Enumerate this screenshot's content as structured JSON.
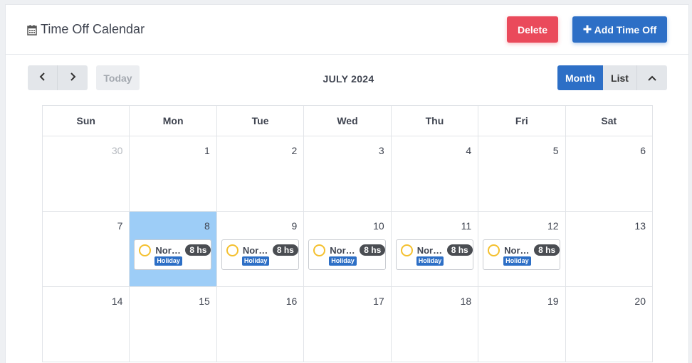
{
  "header": {
    "title": "Time Off Calendar",
    "delete_label": "Delete",
    "add_label": "Add Time Off"
  },
  "toolbar": {
    "today_label": "Today",
    "month_label": "JULY 2024",
    "view_month": "Month",
    "view_list": "List"
  },
  "calendar": {
    "weekdays": [
      "Sun",
      "Mon",
      "Tue",
      "Wed",
      "Thu",
      "Fri",
      "Sat"
    ],
    "weeks": [
      [
        {
          "day": "30",
          "other_month": true
        },
        {
          "day": "1"
        },
        {
          "day": "2"
        },
        {
          "day": "3"
        },
        {
          "day": "4"
        },
        {
          "day": "5"
        },
        {
          "day": "6"
        }
      ],
      [
        {
          "day": "7"
        },
        {
          "day": "8",
          "today": true,
          "event": {
            "name": "Nora...",
            "hours": "8 hs",
            "tag": "Holiday"
          }
        },
        {
          "day": "9",
          "event": {
            "name": "Nora...",
            "hours": "8 hs",
            "tag": "Holiday"
          }
        },
        {
          "day": "10",
          "event": {
            "name": "Nora...",
            "hours": "8 hs",
            "tag": "Holiday"
          }
        },
        {
          "day": "11",
          "event": {
            "name": "Nora...",
            "hours": "8 hs",
            "tag": "Holiday"
          }
        },
        {
          "day": "12",
          "event": {
            "name": "Nora...",
            "hours": "8 hs",
            "tag": "Holiday"
          }
        },
        {
          "day": "13"
        }
      ],
      [
        {
          "day": "14"
        },
        {
          "day": "15"
        },
        {
          "day": "16"
        },
        {
          "day": "17"
        },
        {
          "day": "18"
        },
        {
          "day": "19"
        },
        {
          "day": "20"
        }
      ]
    ]
  },
  "colors": {
    "primary": "#2d6fc6",
    "danger": "#ea4a5b",
    "today_highlight": "#9dcdf7",
    "event_ring": "#f4c02e"
  },
  "icons": {
    "title": "calendar-icon",
    "prev": "chevron-left-icon",
    "next": "chevron-right-icon",
    "add": "plus-icon",
    "collapse": "chevron-up-icon"
  }
}
